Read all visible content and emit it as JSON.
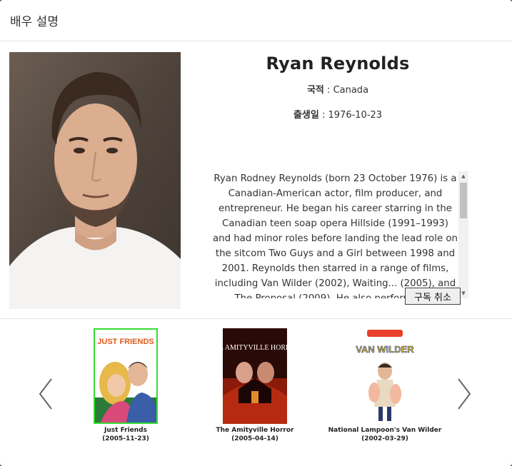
{
  "header": {
    "title": "배우 설명"
  },
  "actor": {
    "name": "Ryan Reynolds",
    "nationality_label": "국적",
    "nationality": "Canada",
    "birth_label": "출생일",
    "birth_date": "1976-10-23",
    "bio": "Ryan Rodney Reynolds (born 23 October 1976) is a Canadian-American actor, film producer, and entrepreneur. He began his career starring in the Canadian teen soap opera Hillside (1991–1993) and had minor roles before landing the lead role on the sitcom Two Guys and a Girl between 1998 and 2001. Reynolds then starred in a range of films, including Van Wilder (2002), Waiting... (2005), and The Proposal (2009). He also performed in dramatic roles"
  },
  "separator": ":",
  "unsubscribe_label": "구독 취소",
  "movies": [
    {
      "title": "Just Friends",
      "date": "(2005-11-23)",
      "poster_text": "JUST FRIENDS",
      "selected": true
    },
    {
      "title": "The Amityville Horror",
      "date": "(2005-04-14)",
      "poster_text": "THE AMITYVILLE HORROR"
    },
    {
      "title": "National Lampoon's Van Wilder",
      "date": "(2002-03-29)",
      "poster_text": "VAN WILDER"
    }
  ],
  "colors": {
    "selected_border": "#33dd33",
    "arrow": "#666666"
  }
}
